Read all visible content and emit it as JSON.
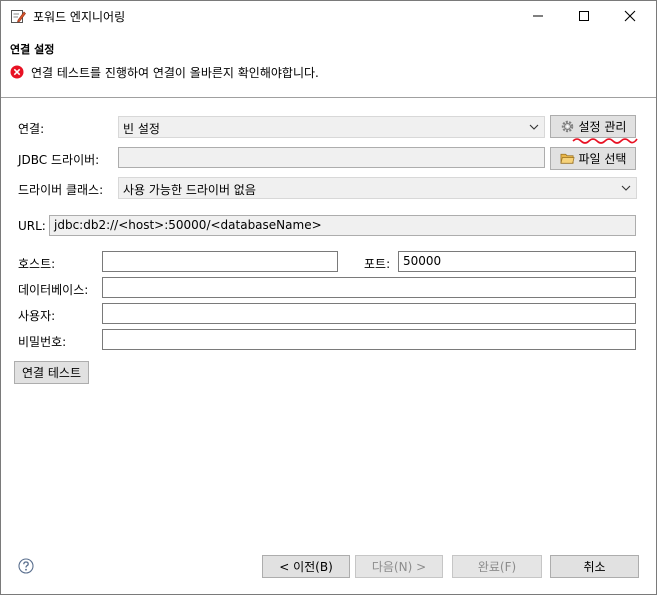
{
  "window": {
    "title": "포워드 엔지니어링",
    "icons": {
      "app": "edit-document-icon",
      "minimize": "minimize-icon",
      "maximize": "maximize-icon",
      "close": "close-icon"
    }
  },
  "header": {
    "title": "연결 설정",
    "error_message": "연결 테스트를 진행하여 연결이 올바른지 확인해야합니다.",
    "error_icon": "error-icon",
    "error_color": "#e81123"
  },
  "form": {
    "connection_label": "연결:",
    "connection_value": "빈 설정",
    "manage_button": "설정 관리",
    "manage_icon": "gear-icon",
    "jdbc_driver_label": "JDBC 드라이버:",
    "jdbc_driver_value": "",
    "file_select_button": "파일 선택",
    "file_select_icon": "folder-icon",
    "driver_class_label": "드라이버 클래스:",
    "driver_class_value": "사용 가능한 드라이버 없음",
    "url_label": "URL:",
    "url_value": "jdbc:db2://<host>:50000/<databaseName>",
    "host_label": "호스트:",
    "host_value": "",
    "port_label": "포트:",
    "port_value": "50000",
    "database_label": "데이터베이스:",
    "database_value": "",
    "user_label": "사용자:",
    "user_value": "",
    "password_label": "비밀번호:",
    "password_value": "",
    "test_button": "연결 테스트"
  },
  "footer": {
    "help_icon": "help-icon",
    "back_button": "< 이전(B)",
    "next_button": "다음(N) >",
    "finish_button": "완료(F)",
    "cancel_button": "취소"
  }
}
